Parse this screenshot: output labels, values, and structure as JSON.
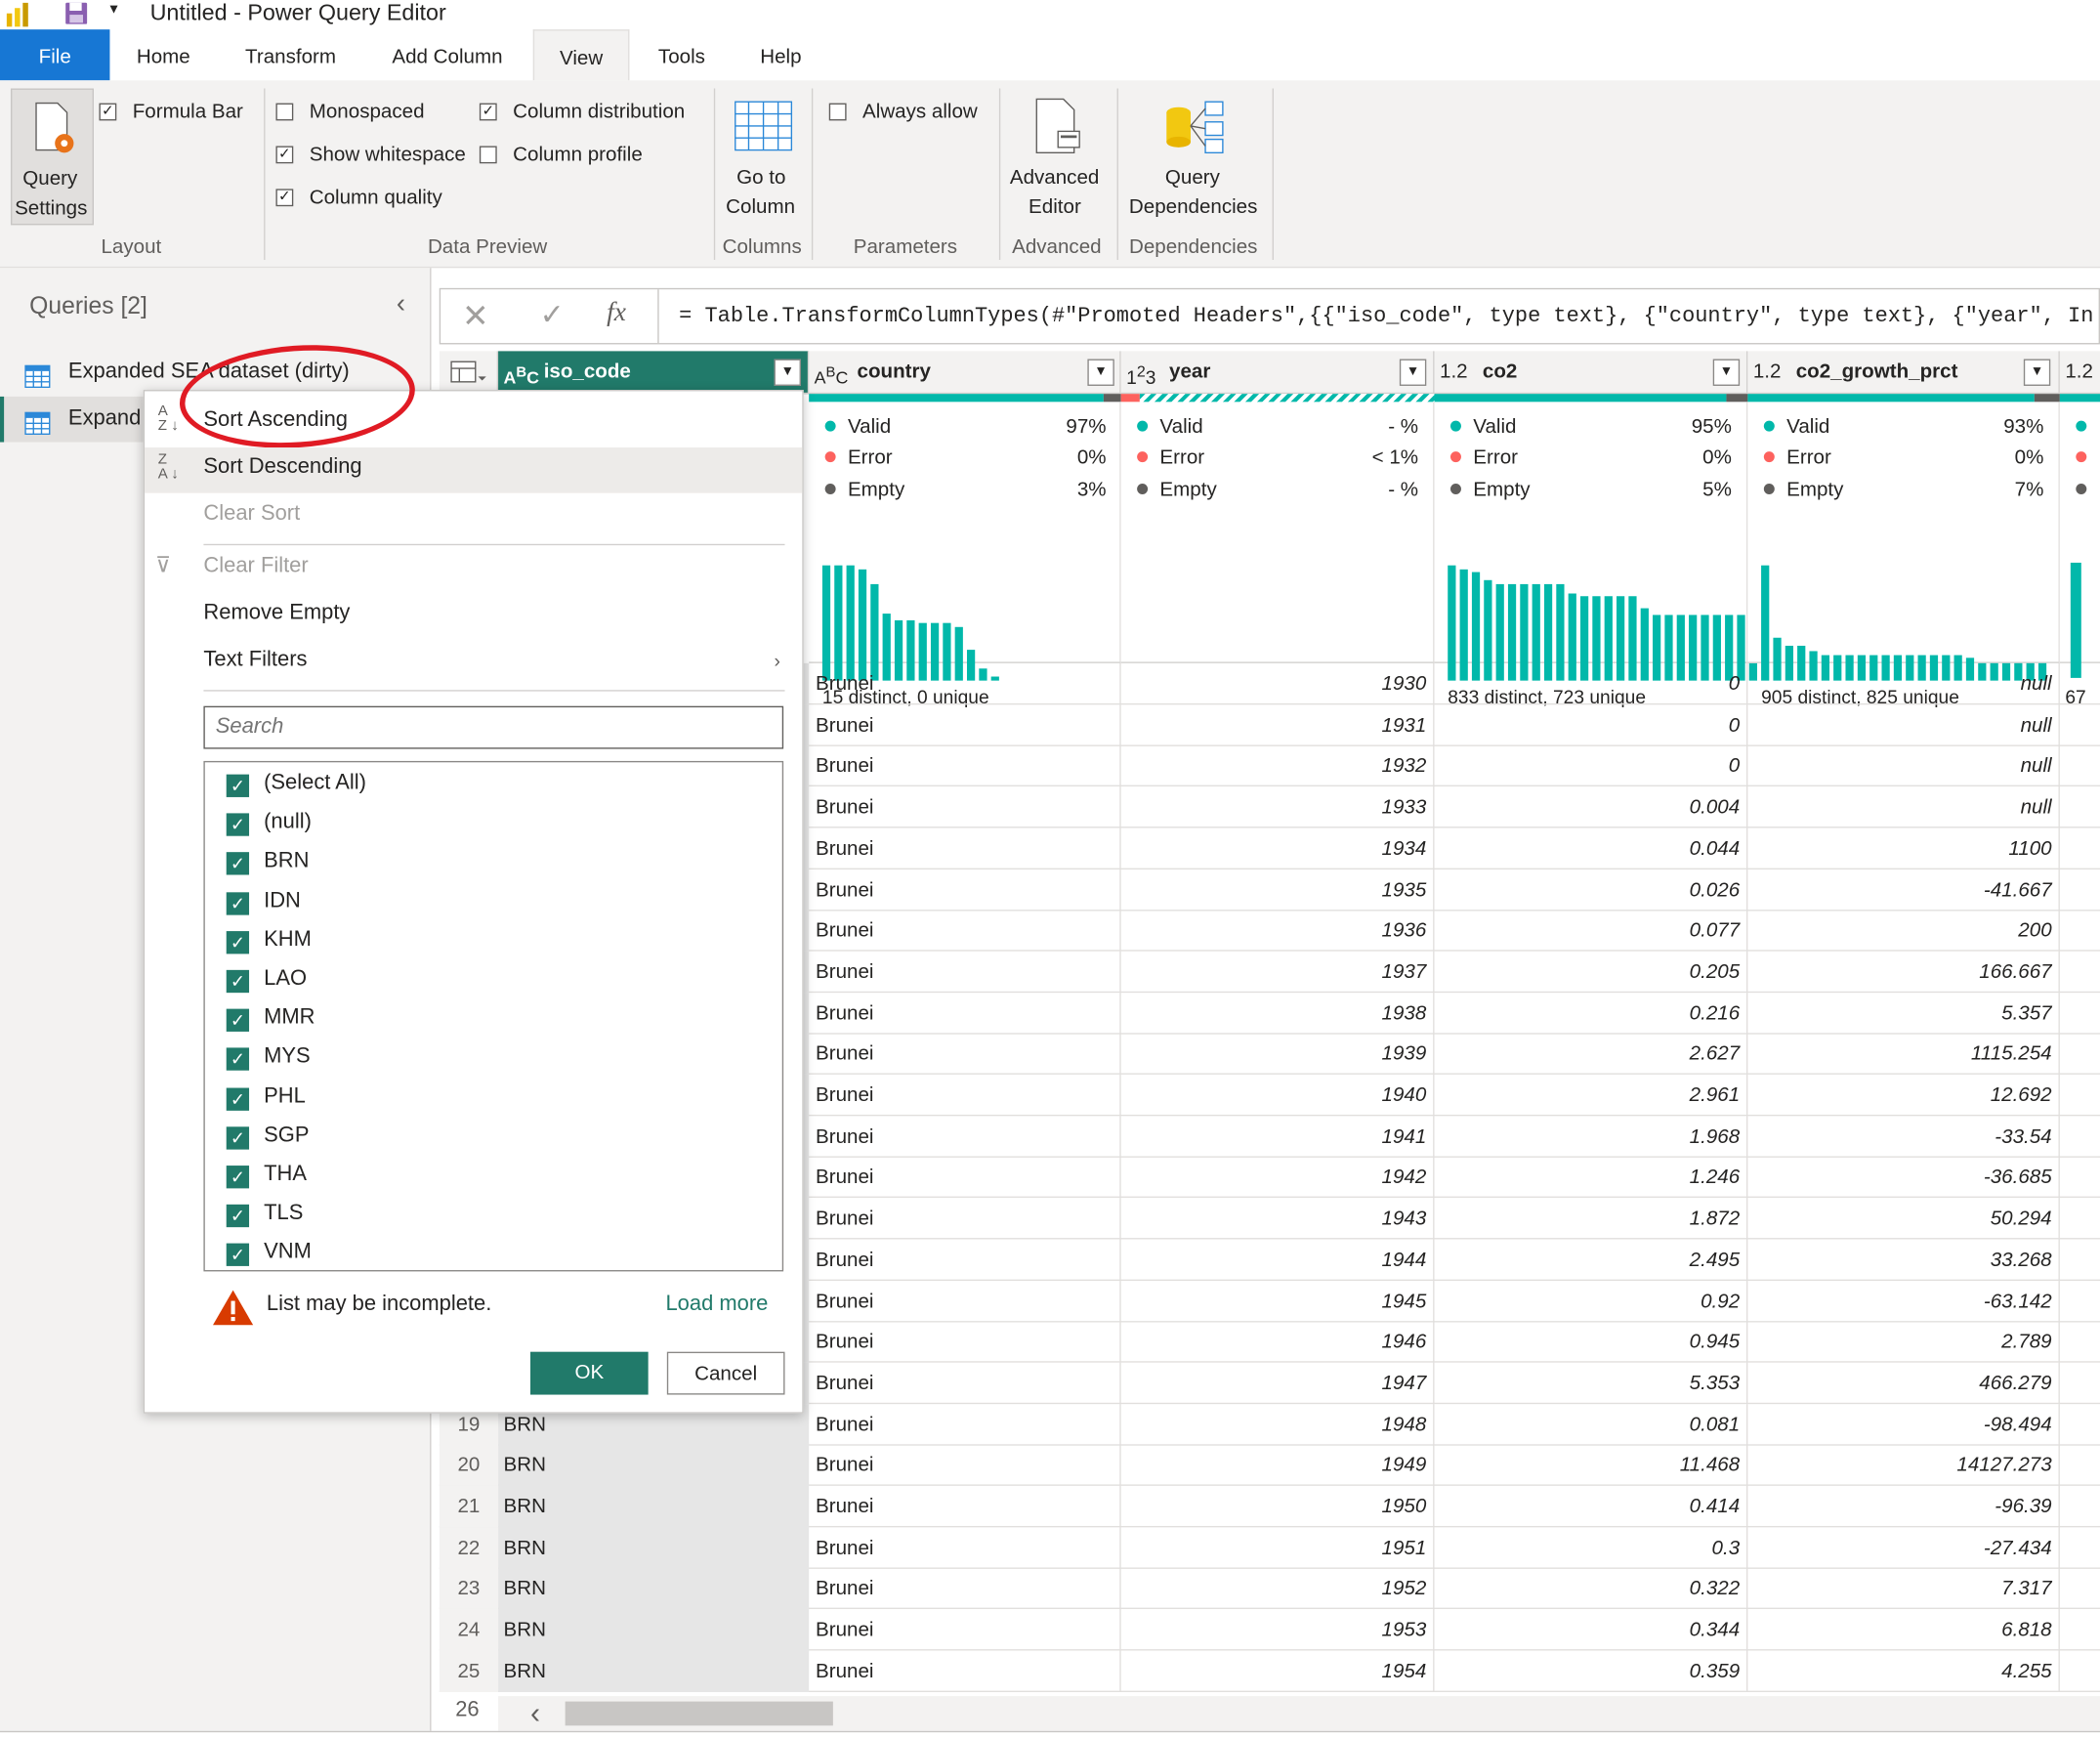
{
  "window": {
    "title": "Untitled - Power Query Editor"
  },
  "tabs": [
    "File",
    "Home",
    "Transform",
    "Add Column",
    "View",
    "Tools",
    "Help"
  ],
  "ribbon": {
    "query_settings": [
      "Query",
      "Settings"
    ],
    "formula_bar": "Formula Bar",
    "monospaced": "Monospaced",
    "show_whitespace": "Show whitespace",
    "column_quality": "Column quality",
    "column_distribution": "Column distribution",
    "column_profile": "Column profile",
    "go_to_column": [
      "Go to",
      "Column"
    ],
    "always_allow": "Always allow",
    "advanced_editor": [
      "Advanced",
      "Editor"
    ],
    "query_dependencies": [
      "Query",
      "Dependencies"
    ],
    "groups": {
      "layout": "Layout",
      "data_preview": "Data Preview",
      "columns": "Columns",
      "parameters": "Parameters",
      "advanced": "Advanced",
      "dependencies": "Dependencies"
    },
    "checked": {
      "formula_bar": true,
      "monospaced": false,
      "show_whitespace": true,
      "column_quality": true,
      "column_distribution": true,
      "column_profile": false,
      "always_allow": false
    }
  },
  "queries": {
    "header": "Queries [2]",
    "items": [
      "Expanded SEA dataset (dirty)",
      "Expand"
    ]
  },
  "formula": {
    "fx": "fx",
    "text": "= Table.TransformColumnTypes(#\"Promoted Headers\",{{\"iso_code\", type text}, {\"country\", type text}, {\"year\", In"
  },
  "columns": [
    {
      "type_icon": "ABC",
      "name": "iso_code"
    },
    {
      "type_icon": "ABC",
      "name": "country",
      "valid": "97%",
      "error": "0%",
      "empty": "3%",
      "distinct": "15 distinct, 0 unique"
    },
    {
      "type_icon": "123",
      "name": "year",
      "valid": "- %",
      "error": "< 1%",
      "empty": "- %"
    },
    {
      "type_icon": "1.2",
      "name": "co2",
      "valid": "95%",
      "error": "0%",
      "empty": "5%",
      "distinct": "833 distinct, 723 unique"
    },
    {
      "type_icon": "1.2",
      "name": "co2_growth_prct",
      "valid": "93%",
      "error": "0%",
      "empty": "7%",
      "distinct": "905 distinct, 825 unique"
    },
    {
      "type_icon": "1.2",
      "name": "",
      "distinct": "67"
    }
  ],
  "profile_labels": {
    "valid": "Valid",
    "error": "Error",
    "empty": "Empty"
  },
  "colors": {
    "accent": "#217a6a",
    "valid": "#01b8aa",
    "error": "#fd625e",
    "empty": "#605e5c",
    "file_tab": "#1777d4"
  },
  "rows": [
    {
      "n": "",
      "iso": "",
      "country": "Brunei",
      "year": "1930",
      "co2": "0",
      "growth": "null"
    },
    {
      "n": "",
      "iso": "",
      "country": "Brunei",
      "year": "1931",
      "co2": "0",
      "growth": "null"
    },
    {
      "n": "",
      "iso": "",
      "country": "Brunei",
      "year": "1932",
      "co2": "0",
      "growth": "null"
    },
    {
      "n": "",
      "iso": "",
      "country": "Brunei",
      "year": "1933",
      "co2": "0.004",
      "growth": "null"
    },
    {
      "n": "",
      "iso": "",
      "country": "Brunei",
      "year": "1934",
      "co2": "0.044",
      "growth": "1100"
    },
    {
      "n": "",
      "iso": "",
      "country": "Brunei",
      "year": "1935",
      "co2": "0.026",
      "growth": "-41.667"
    },
    {
      "n": "",
      "iso": "",
      "country": "Brunei",
      "year": "1936",
      "co2": "0.077",
      "growth": "200"
    },
    {
      "n": "",
      "iso": "",
      "country": "Brunei",
      "year": "1937",
      "co2": "0.205",
      "growth": "166.667"
    },
    {
      "n": "",
      "iso": "",
      "country": "Brunei",
      "year": "1938",
      "co2": "0.216",
      "growth": "5.357"
    },
    {
      "n": "",
      "iso": "",
      "country": "Brunei",
      "year": "1939",
      "co2": "2.627",
      "growth": "1115.254"
    },
    {
      "n": "",
      "iso": "",
      "country": "Brunei",
      "year": "1940",
      "co2": "2.961",
      "growth": "12.692"
    },
    {
      "n": "",
      "iso": "",
      "country": "Brunei",
      "year": "1941",
      "co2": "1.968",
      "growth": "-33.54"
    },
    {
      "n": "",
      "iso": "",
      "country": "Brunei",
      "year": "1942",
      "co2": "1.246",
      "growth": "-36.685"
    },
    {
      "n": "",
      "iso": "",
      "country": "Brunei",
      "year": "1943",
      "co2": "1.872",
      "growth": "50.294"
    },
    {
      "n": "",
      "iso": "",
      "country": "Brunei",
      "year": "1944",
      "co2": "2.495",
      "growth": "33.268"
    },
    {
      "n": "",
      "iso": "",
      "country": "Brunei",
      "year": "1945",
      "co2": "0.92",
      "growth": "-63.142"
    },
    {
      "n": "",
      "iso": "",
      "country": "Brunei",
      "year": "1946",
      "co2": "0.945",
      "growth": "2.789"
    },
    {
      "n": "",
      "iso": "",
      "country": "Brunei",
      "year": "1947",
      "co2": "5.353",
      "growth": "466.279"
    },
    {
      "n": "19",
      "iso": "BRN",
      "country": "Brunei",
      "year": "1948",
      "co2": "0.081",
      "growth": "-98.494"
    },
    {
      "n": "20",
      "iso": "BRN",
      "country": "Brunei",
      "year": "1949",
      "co2": "11.468",
      "growth": "14127.273"
    },
    {
      "n": "21",
      "iso": "BRN",
      "country": "Brunei",
      "year": "1950",
      "co2": "0.414",
      "growth": "-96.39"
    },
    {
      "n": "22",
      "iso": "BRN",
      "country": "Brunei",
      "year": "1951",
      "co2": "0.3",
      "growth": "-27.434"
    },
    {
      "n": "23",
      "iso": "BRN",
      "country": "Brunei",
      "year": "1952",
      "co2": "0.322",
      "growth": "7.317"
    },
    {
      "n": "24",
      "iso": "BRN",
      "country": "Brunei",
      "year": "1953",
      "co2": "0.344",
      "growth": "6.818"
    },
    {
      "n": "25",
      "iso": "BRN",
      "country": "Brunei",
      "year": "1954",
      "co2": "0.359",
      "growth": "4.255"
    },
    {
      "n": "26",
      "iso": "",
      "country": "",
      "year": "",
      "co2": "",
      "growth": ""
    }
  ],
  "menu": {
    "sort_ascending": "Sort Ascending",
    "sort_descending": "Sort Descending",
    "clear_sort": "Clear Sort",
    "clear_filter": "Clear Filter",
    "remove_empty": "Remove Empty",
    "text_filters": "Text Filters",
    "search_placeholder": "Search",
    "filter_items": [
      "(Select All)",
      "(null)",
      "BRN",
      "IDN",
      "KHM",
      "LAO",
      "MMR",
      "MYS",
      "PHL",
      "SGP",
      "THA",
      "TLS",
      "VNM"
    ],
    "warning": "List may be incomplete.",
    "load_more": "Load more",
    "ok": "OK",
    "cancel": "Cancel"
  },
  "distributions": {
    "country": [
      1.0,
      1.0,
      1.0,
      0.97,
      0.84,
      0.58,
      0.52,
      0.52,
      0.5,
      0.5,
      0.5,
      0.46,
      0.27,
      0.1,
      0.03
    ],
    "co2": [
      1.0,
      0.97,
      0.94,
      0.87,
      0.84,
      0.84,
      0.84,
      0.84,
      0.84,
      0.84,
      0.76,
      0.73,
      0.73,
      0.73,
      0.73,
      0.73,
      0.63,
      0.57,
      0.57,
      0.57,
      0.57,
      0.57,
      0.57,
      0.57,
      0.57,
      0.57
    ],
    "growth": [
      1.0,
      0.37,
      0.3,
      0.3,
      0.26,
      0.22,
      0.22,
      0.22,
      0.22,
      0.22,
      0.22,
      0.22,
      0.22,
      0.22,
      0.22,
      0.22,
      0.22,
      0.2,
      0.15,
      0.15,
      0.15,
      0.15,
      0.15,
      0.15
    ]
  }
}
